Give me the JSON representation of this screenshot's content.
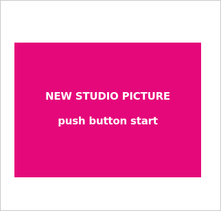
{
  "panel": {
    "title": "NEW STUDIO PICTURE",
    "action": "push button start",
    "background_color": "#e5087a",
    "text_color": "#ffffff"
  },
  "frame": {
    "border_color": "#c8c8c8",
    "background_color": "#ffffff"
  }
}
